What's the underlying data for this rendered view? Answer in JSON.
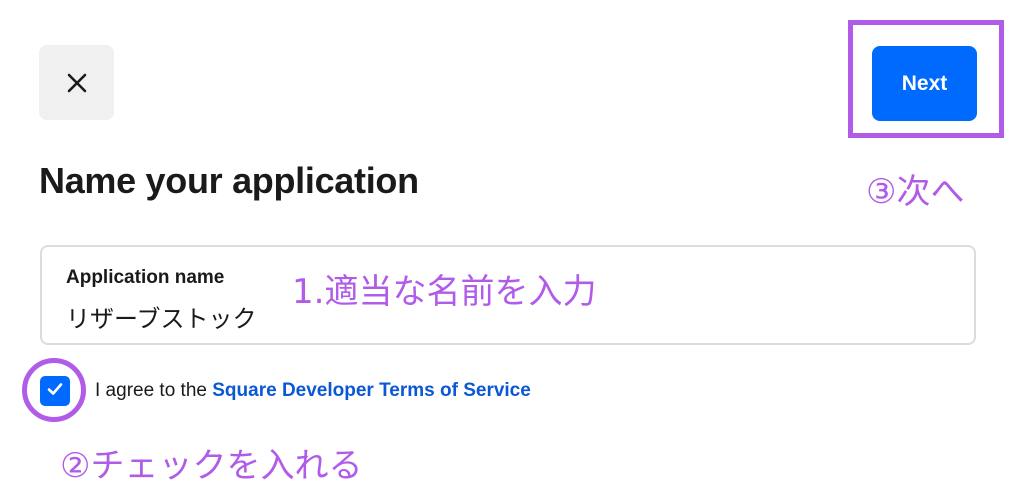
{
  "header": {
    "close_icon": "close-icon",
    "next_label": "Next"
  },
  "form": {
    "title": "Name your application",
    "field_label": "Application name",
    "field_value": "リザーブストック",
    "checkbox_checked": true,
    "agree_prefix": "I agree to the ",
    "terms_link": "Square Developer Terms of Service"
  },
  "annotations": {
    "step1": "1.適当な名前を入力",
    "step2": "②チェックを入れる",
    "step3": "③次へ"
  },
  "colors": {
    "accent": "#006aff",
    "annotation": "#b15ce8",
    "link": "#0a58d6"
  }
}
